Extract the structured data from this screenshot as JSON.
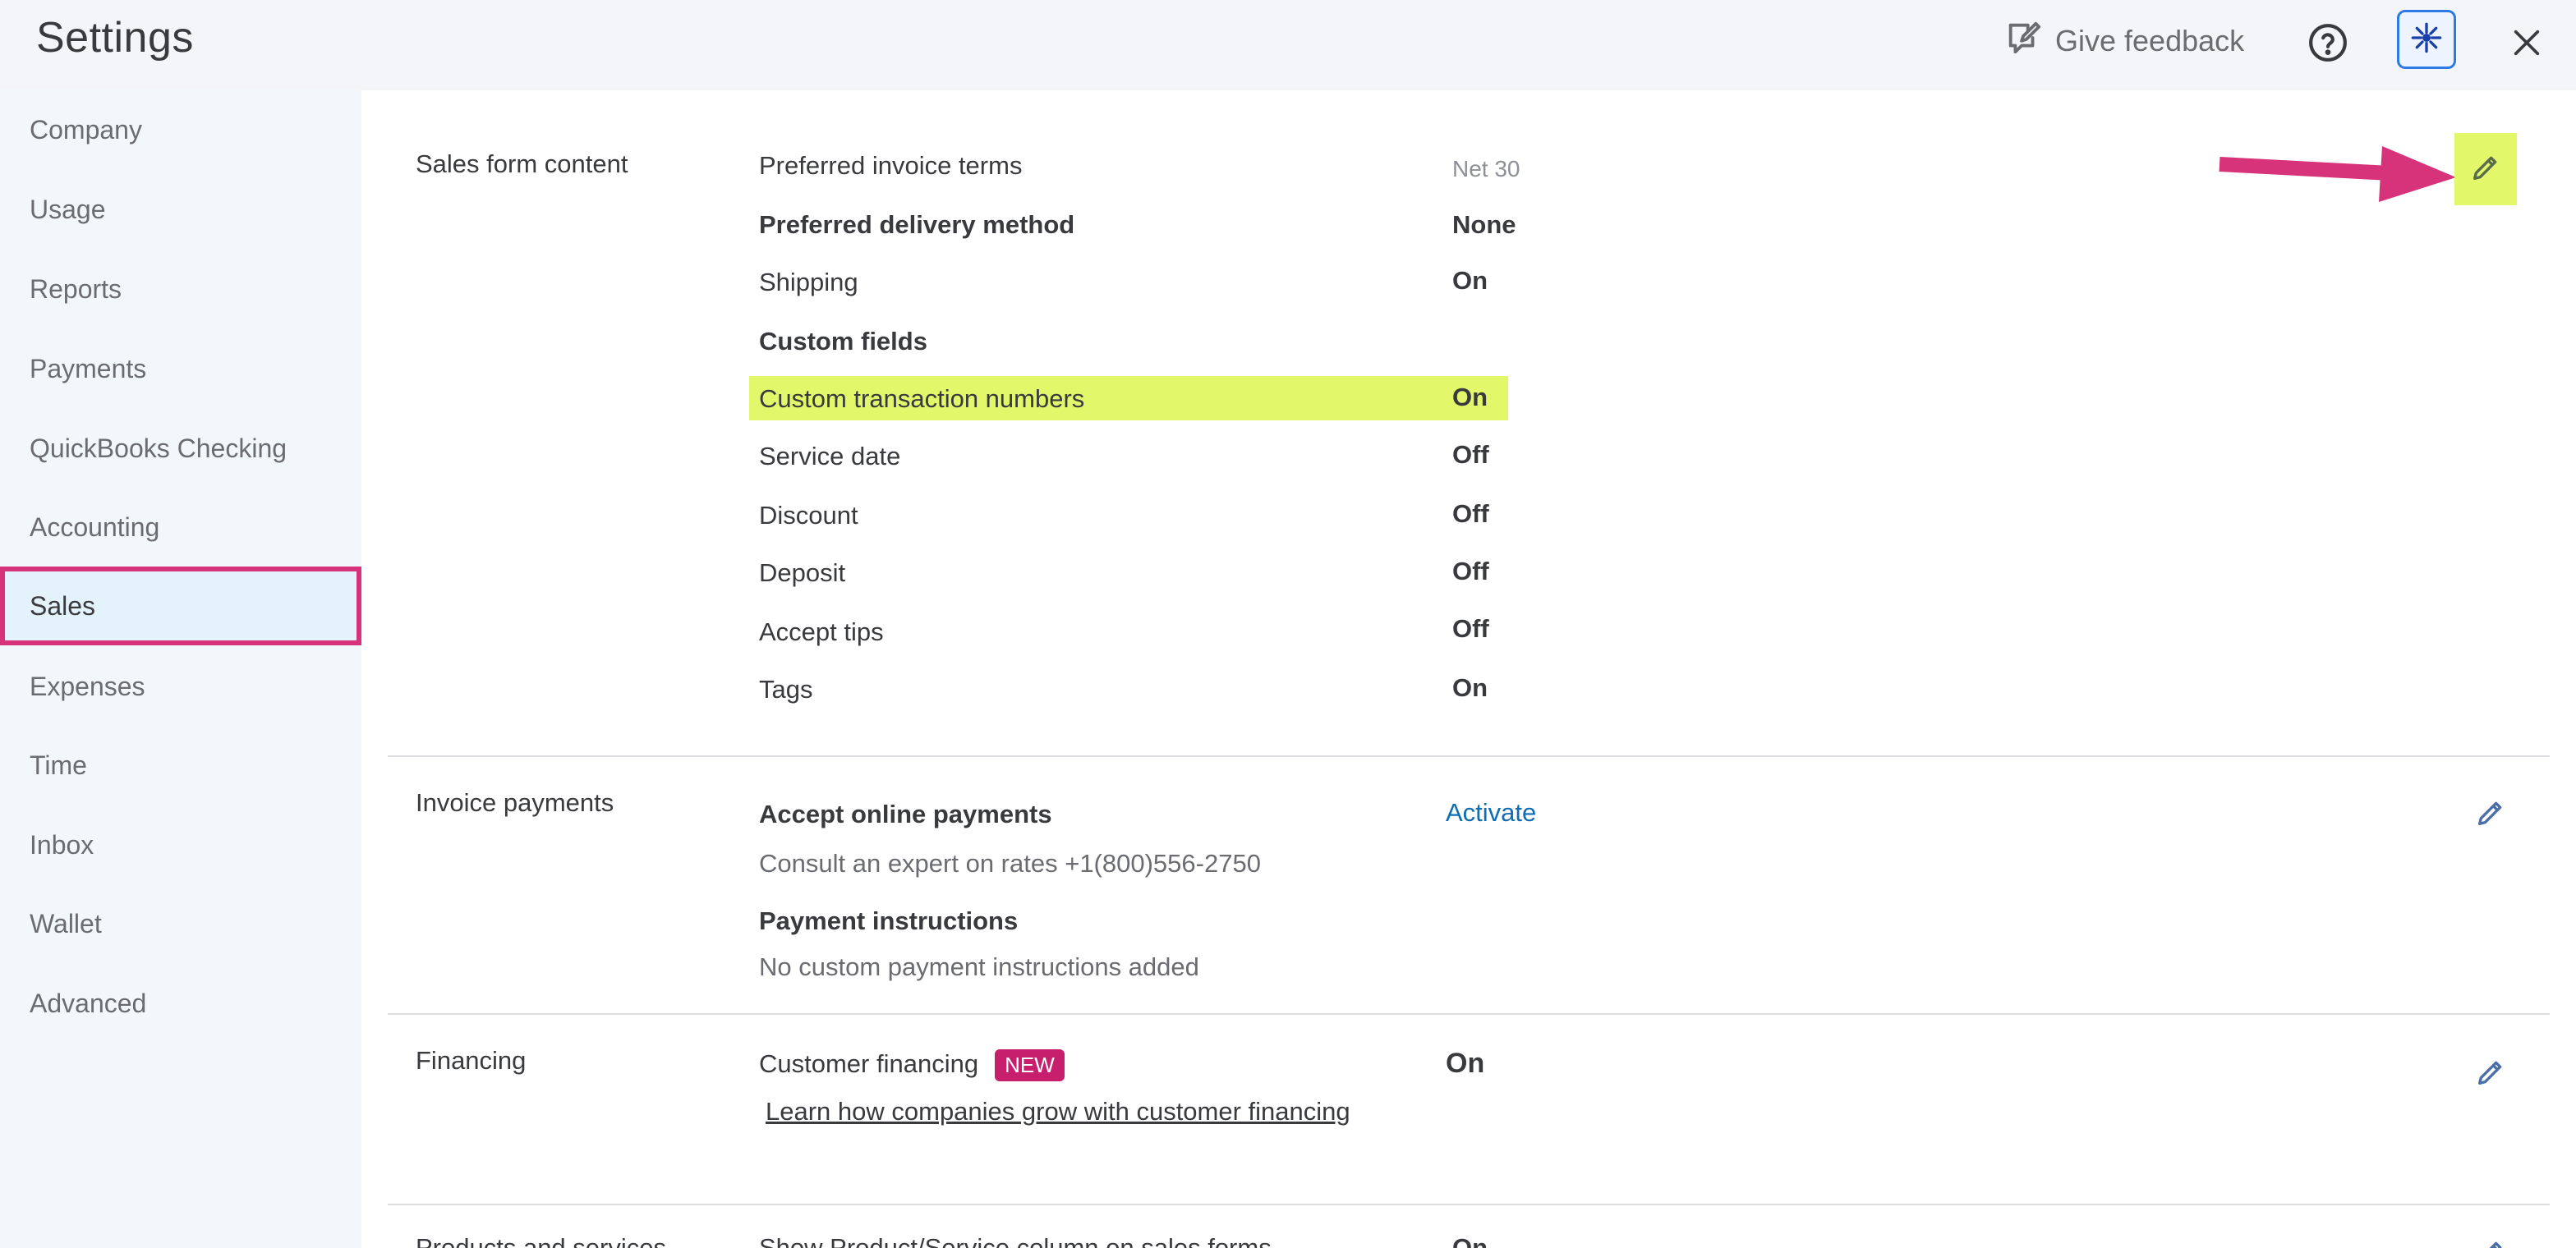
{
  "header": {
    "title": "Settings",
    "feedback_label": "Give feedback",
    "icons": [
      "feedback-icon",
      "help-icon",
      "assistant-icon",
      "close-icon"
    ]
  },
  "sidebar": {
    "items": [
      {
        "label": "Company"
      },
      {
        "label": "Usage"
      },
      {
        "label": "Reports"
      },
      {
        "label": "Payments"
      },
      {
        "label": "QuickBooks Checking"
      },
      {
        "label": "Accounting"
      },
      {
        "label": "Sales"
      },
      {
        "label": "Expenses"
      },
      {
        "label": "Time"
      },
      {
        "label": "Inbox"
      },
      {
        "label": "Wallet"
      },
      {
        "label": "Advanced"
      }
    ],
    "active": "Sales"
  },
  "sales_form": {
    "label": "Sales form content",
    "rows": [
      {
        "label": "Preferred invoice terms",
        "value": "Net 30"
      },
      {
        "label": "Preferred delivery method",
        "value": "None"
      },
      {
        "label": "Shipping",
        "value": "On"
      },
      {
        "label": "Custom fields",
        "value": ""
      },
      {
        "label": "Custom transaction numbers",
        "value": "On"
      },
      {
        "label": "Service date",
        "value": "Off"
      },
      {
        "label": "Discount",
        "value": "Off"
      },
      {
        "label": "Deposit",
        "value": "Off"
      },
      {
        "label": "Accept tips",
        "value": "Off"
      },
      {
        "label": "Tags",
        "value": "On"
      }
    ]
  },
  "invoice_payments": {
    "label": "Invoice payments",
    "accept_label": "Accept online payments",
    "accept_action": "Activate",
    "consult_text": "Consult an expert on rates +1(800)556-2750",
    "instructions_label": "Payment instructions",
    "instructions_text": "No custom payment instructions added"
  },
  "financing": {
    "label": "Financing",
    "customer_label": "Customer financing",
    "badge": "NEW",
    "value": "On",
    "link": "Learn how companies grow with customer financing"
  },
  "products": {
    "label": "Products and services",
    "row_label": "Show Product/Service column on sales forms",
    "value": "On"
  },
  "colors": {
    "highlight": "#e2f76a",
    "annotation": "#d6337a",
    "link": "#0d6db5",
    "badge": "#c81e6e"
  }
}
